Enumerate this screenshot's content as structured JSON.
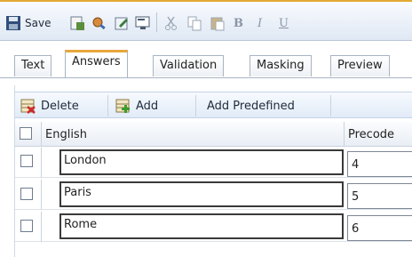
{
  "toolbar": {
    "save_label": "Save",
    "icons": [
      "save-icon",
      "spell-check-icon",
      "find-icon",
      "edit-icon",
      "preview-icon",
      "cut-icon",
      "copy-icon",
      "paste-icon",
      "bold-icon",
      "italic-icon",
      "underline-icon"
    ],
    "bold_glyph": "B",
    "italic_glyph": "I",
    "underline_glyph": "U"
  },
  "tabs": [
    {
      "label": "Text",
      "active": false
    },
    {
      "label": "Answers",
      "active": true
    },
    {
      "label": "Validation",
      "active": false
    },
    {
      "label": "Masking",
      "active": false
    },
    {
      "label": "Preview",
      "active": false
    }
  ],
  "actions": {
    "delete_label": "Delete",
    "add_label": "Add",
    "add_predefined_label": "Add Predefined"
  },
  "grid": {
    "columns": [
      "English",
      "Precode"
    ],
    "rows": [
      {
        "english": "London",
        "precode": "4"
      },
      {
        "english": "Paris",
        "precode": "5"
      },
      {
        "english": "Rome",
        "precode": "6"
      }
    ]
  },
  "colors": {
    "accent": "#e8a73c",
    "toolbar_bg": "#dfe8f4"
  }
}
